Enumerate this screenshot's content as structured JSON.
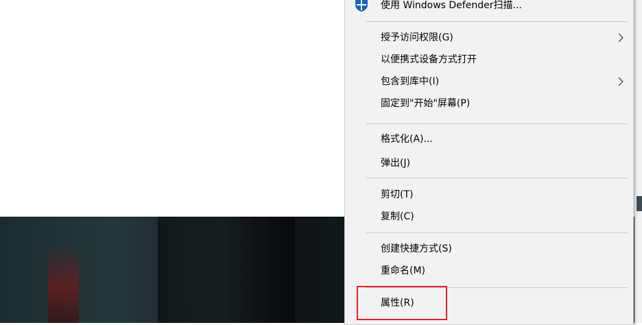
{
  "menu": {
    "defender": "使用 Windows Defender扫描...",
    "grant_access": "授予访问权限(G)",
    "portable_open": "以便携式设备方式打开",
    "include_library": "包含到库中(I)",
    "pin_start": "固定到\"开始\"屏幕(P)",
    "format": "格式化(A)...",
    "eject": "弹出(J)",
    "cut": "剪切(T)",
    "copy": "复制(C)",
    "create_shortcut": "创建快捷方式(S)",
    "rename": "重命名(M)",
    "properties": "属性(R)"
  },
  "colors": {
    "menu_bg": "#f2f2f2",
    "highlight": "#e0212a",
    "defender_blue": "#1565c0"
  },
  "icons": {
    "defender": "windows-defender-shield-icon",
    "submenu": "chevron-right-icon"
  }
}
